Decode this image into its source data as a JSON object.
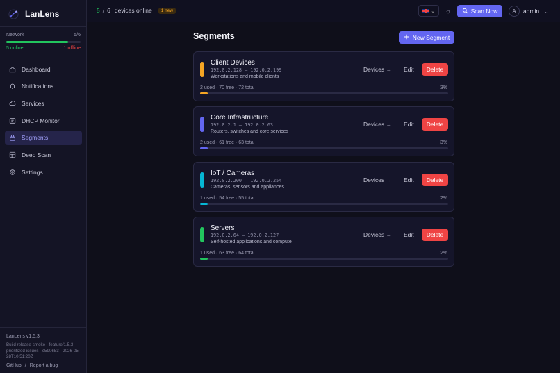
{
  "app": {
    "name": "LanLens"
  },
  "network": {
    "label": "Network",
    "count": "5/6",
    "online_fraction": 0.833,
    "online_text": "5 online",
    "offline_text": "1 offline"
  },
  "nav": {
    "items": [
      {
        "label": "Dashboard",
        "icon": "dashboard-icon",
        "active": false
      },
      {
        "label": "Notifications",
        "icon": "bell-icon",
        "active": false
      },
      {
        "label": "Services",
        "icon": "services-icon",
        "active": false
      },
      {
        "label": "DHCP Monitor",
        "icon": "monitor-icon",
        "active": false
      },
      {
        "label": "Segments",
        "icon": "lock-icon",
        "active": true
      },
      {
        "label": "Deep Scan",
        "icon": "grid-icon",
        "active": false
      },
      {
        "label": "Settings",
        "icon": "gear-icon",
        "active": false
      }
    ]
  },
  "footer": {
    "version": "LanLens v1.5.3",
    "build": "Build release-smoke · feature/1.5.3-prioritized-issues · c590653 · 2026-05-28T10:51:20Z",
    "github": "GitHub",
    "separator": "/",
    "report": "Report a bug"
  },
  "topbar": {
    "online_count": "5",
    "slash": "/",
    "total_count": "6",
    "online_label": "devices online",
    "new_badge": "1 new",
    "lang_chevron": "⌄",
    "theme_icon": "☼",
    "scan_label": "Scan Now",
    "user_initial": "A",
    "user_name": "admin",
    "user_chevron": "⌄"
  },
  "page": {
    "title": "Segments",
    "new_button": "New Segment"
  },
  "segments": [
    {
      "name": "Client Devices",
      "range": "192.0.2.128 – 192.0.2.199",
      "description": "Workstations and mobile clients",
      "usage": "2 used · 70 free · 72 total",
      "percent_label": "3%",
      "usage_fraction": 0.03,
      "color": "#f5a524",
      "devices_label": "Devices →",
      "edit_label": "Edit",
      "delete_label": "Delete"
    },
    {
      "name": "Core Infrastructure",
      "range": "192.0.2.1 – 192.0.2.63",
      "description": "Routers, switches and core services",
      "usage": "2 used · 61 free · 63 total",
      "percent_label": "3%",
      "usage_fraction": 0.03,
      "color": "#6366f1",
      "devices_label": "Devices →",
      "edit_label": "Edit",
      "delete_label": "Delete"
    },
    {
      "name": "IoT / Cameras",
      "range": "192.0.2.200 – 192.0.2.254",
      "description": "Cameras, sensors and appliances",
      "usage": "1 used · 54 free · 55 total",
      "percent_label": "2%",
      "usage_fraction": 0.02,
      "color": "#06b6d4",
      "devices_label": "Devices →",
      "edit_label": "Edit",
      "delete_label": "Delete"
    },
    {
      "name": "Servers",
      "range": "192.0.2.64 – 192.0.2.127",
      "description": "Self-hosted applications and compute",
      "usage": "1 used · 63 free · 64 total",
      "percent_label": "2%",
      "usage_fraction": 0.02,
      "color": "#22c55e",
      "devices_label": "Devices →",
      "edit_label": "Edit",
      "delete_label": "Delete"
    }
  ],
  "colors": {
    "accent": "#6366f1",
    "danger": "#ef4444",
    "success": "#22c55e",
    "warning": "#f5a524"
  }
}
